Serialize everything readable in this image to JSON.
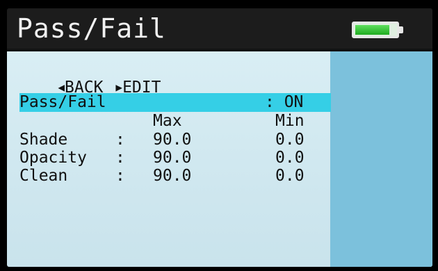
{
  "header": {
    "title": "Pass/Fail",
    "battery_level": 0.85,
    "battery_color": "#2fc42f"
  },
  "nav": {
    "back_label": "BACK",
    "edit_label": "EDIT"
  },
  "setting": {
    "label": "Pass/Fail",
    "value": ": ON"
  },
  "table": {
    "columns": {
      "max": "Max",
      "min": "Min"
    },
    "rows": [
      {
        "label": "Shade",
        "sep": ":",
        "max": "90.0",
        "min": "0.0"
      },
      {
        "label": "Opacity",
        "sep": ":",
        "max": "90.0",
        "min": "0.0"
      },
      {
        "label": "Clean",
        "sep": ":",
        "max": "90.0",
        "min": "0.0"
      }
    ]
  },
  "colors": {
    "highlight": "#35cfe6",
    "panel": "#d9eef4",
    "side_panel": "#7cc1dc"
  }
}
